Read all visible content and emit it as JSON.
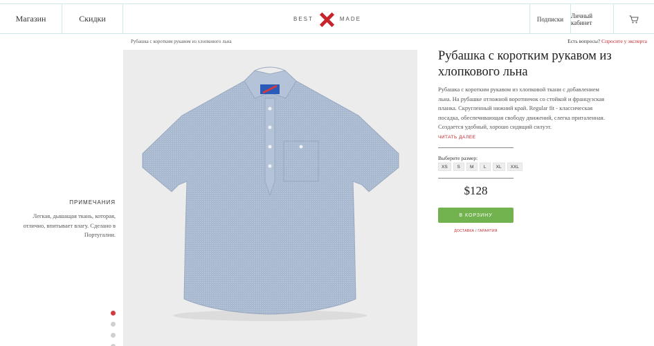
{
  "header": {
    "nav_shop": "Магазин",
    "nav_sale": "Скидки",
    "logo_left": "BEST",
    "logo_right": "MADE",
    "nav_subscribe": "Подписки",
    "nav_account": "Личный кабинет",
    "cart_icon": "cart-icon"
  },
  "breadcrumb": "Рубашка с коротким рукавом из хлопкового льна",
  "expert": {
    "question": "Есть вопросы?",
    "link": "Спросите у эксперта"
  },
  "notes": {
    "title": "ПРИМЕЧАНИЯ",
    "text": "Легкая, дышащая ткань, которая, отлично, впитывает влагу. Сделано в Португалии."
  },
  "gallery": {
    "dots": [
      true,
      false,
      false,
      false
    ],
    "active_color": "#d23a3f"
  },
  "product": {
    "title": "Рубашка с коротким рукавом из хлопкового льна",
    "description": "Рубашка с коротким рукавом из хлопковой ткани с добавлением льна. На рубашке отложной воротничок со стойкой и французская планка. Скругленный нижний край. Regular fit - классическая посадка, обеспечивающая свободу движений, слегка приталенная. Создается удобный, хорошо сидящий силуэт.",
    "read_more": "ЧИТАТЬ ДАЛЕЕ",
    "size_label": "Выберите размер:",
    "sizes": [
      "XS",
      "S",
      "M",
      "L",
      "XL",
      "XXL"
    ],
    "price": "$128",
    "add_to_cart": "В КОРЗИНУ",
    "shipping": "ДОСТАВКА",
    "separator": "/",
    "warranty": "ГАРАНТИЯ"
  },
  "colors": {
    "accent": "#c7242b",
    "button": "#73b34f",
    "border": "#cfe8e8"
  }
}
